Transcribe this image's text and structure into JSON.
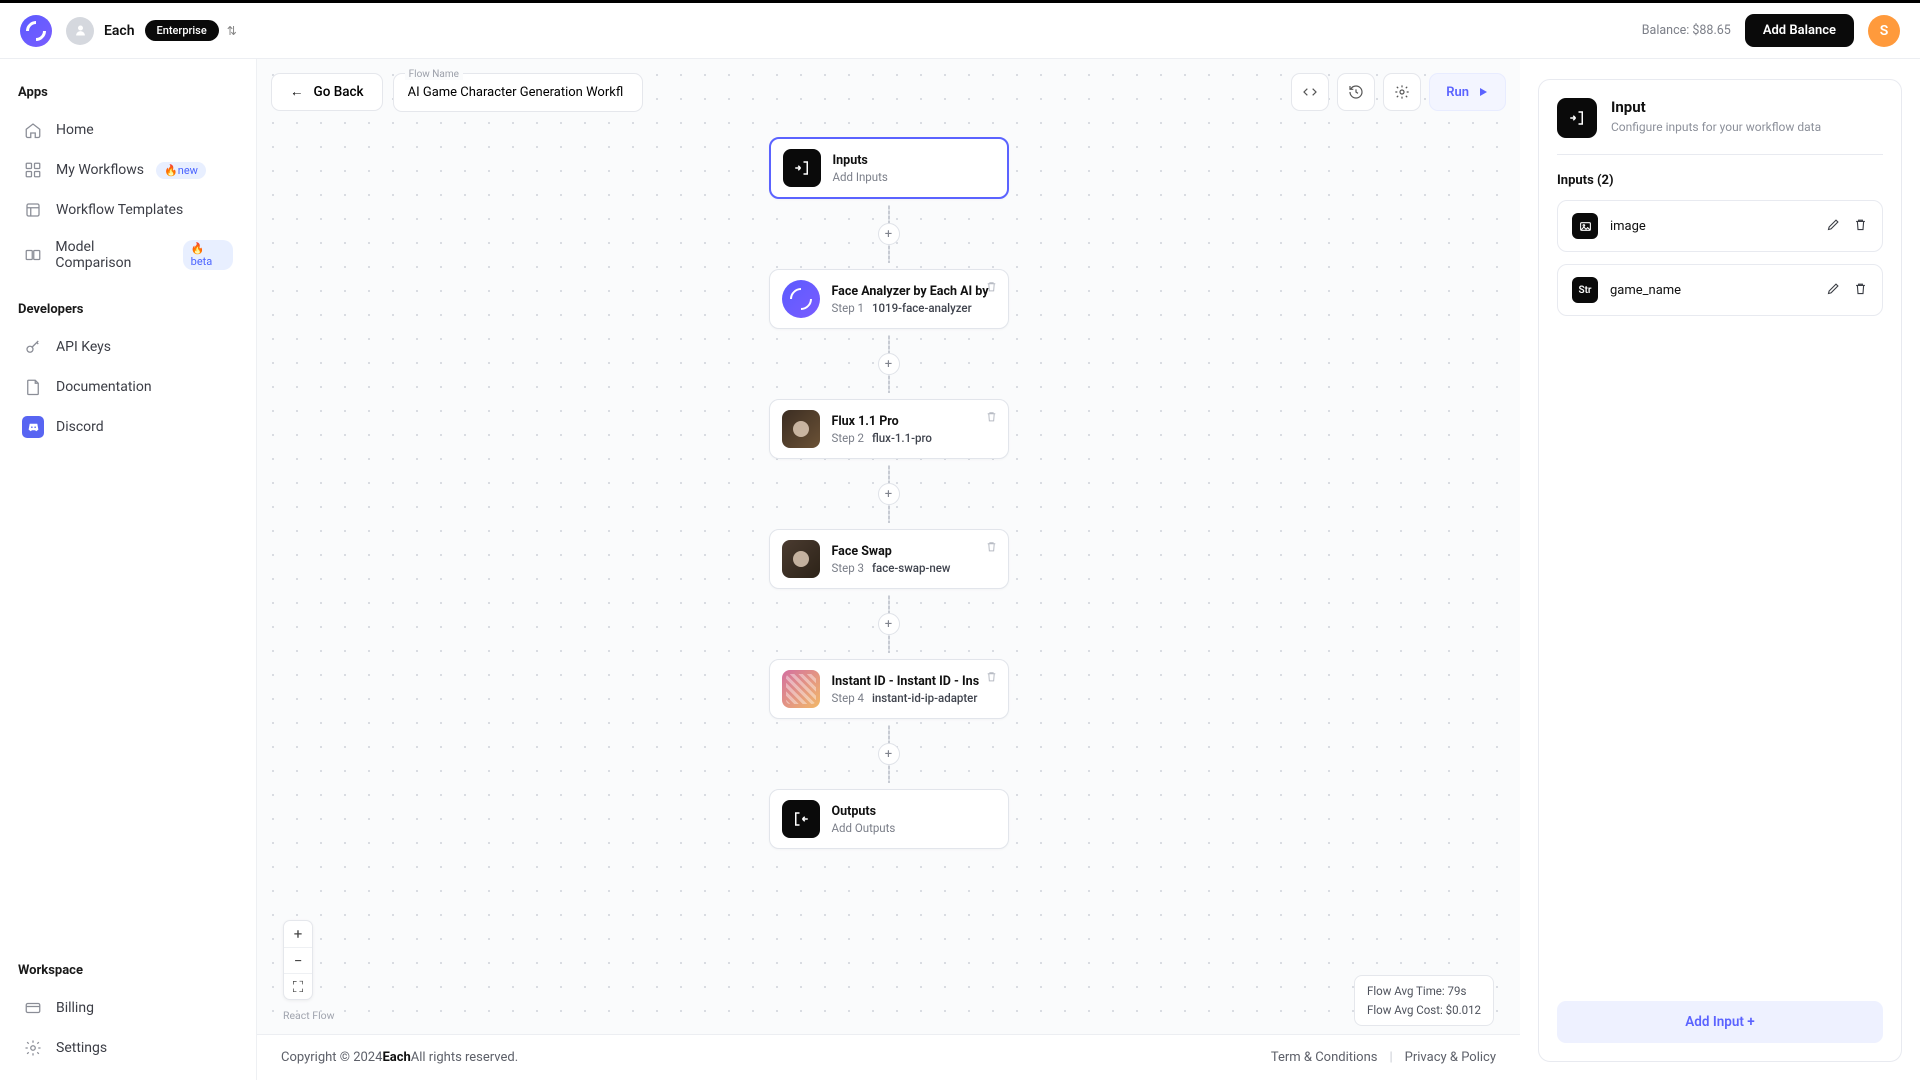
{
  "header": {
    "brand": "Each",
    "plan": "Enterprise",
    "balance_label": "Balance: $88.65",
    "add_balance": "Add Balance",
    "avatar_initial": "S"
  },
  "sidebar": {
    "apps_label": "Apps",
    "items": [
      {
        "label": "Home"
      },
      {
        "label": "My Workflows",
        "badge": "new"
      },
      {
        "label": "Workflow Templates"
      },
      {
        "label": "Model Comparison",
        "badge": "beta"
      }
    ],
    "dev_label": "Developers",
    "dev_items": [
      {
        "label": "API Keys"
      },
      {
        "label": "Documentation"
      },
      {
        "label": "Discord"
      }
    ],
    "workspace_label": "Workspace",
    "ws_items": [
      {
        "label": "Billing"
      },
      {
        "label": "Settings"
      }
    ]
  },
  "toolbar": {
    "go_back": "Go Back",
    "flow_name_label": "Flow Name",
    "flow_name": "AI Game Character Generation Workfl",
    "run": "Run"
  },
  "nodes": {
    "inputs": {
      "title": "Inputs",
      "sub": "Add Inputs"
    },
    "step1": {
      "title": "Face Analyzer by Each AI by",
      "step": "Step 1",
      "slug": "1019-face-analyzer"
    },
    "step2": {
      "title": "Flux 1.1 Pro",
      "step": "Step 2",
      "slug": "flux-1.1-pro"
    },
    "step3": {
      "title": "Face Swap",
      "step": "Step 3",
      "slug": "face-swap-new"
    },
    "step4": {
      "title": "Instant ID - Instant ID - Ins",
      "step": "Step 4",
      "slug": "instant-id-ip-adapter"
    },
    "outputs": {
      "title": "Outputs",
      "sub": "Add Outputs"
    }
  },
  "stats": {
    "time": "Flow Avg Time: 79s",
    "cost": "Flow Avg Cost: $0.012"
  },
  "reactflow": "React Flow",
  "panel": {
    "title": "Input",
    "desc": "Configure inputs for your workflow data",
    "section": "Inputs (2)",
    "rows": [
      {
        "name": "image",
        "type": "image"
      },
      {
        "name": "game_name",
        "type": "Str"
      }
    ],
    "add": "Add Input +"
  },
  "footer": {
    "copyright_pre": "Copyright © 2024 ",
    "brand": "Each",
    "copyright_post": " All rights reserved.",
    "terms": "Term & Conditions",
    "privacy": "Privacy & Policy"
  }
}
